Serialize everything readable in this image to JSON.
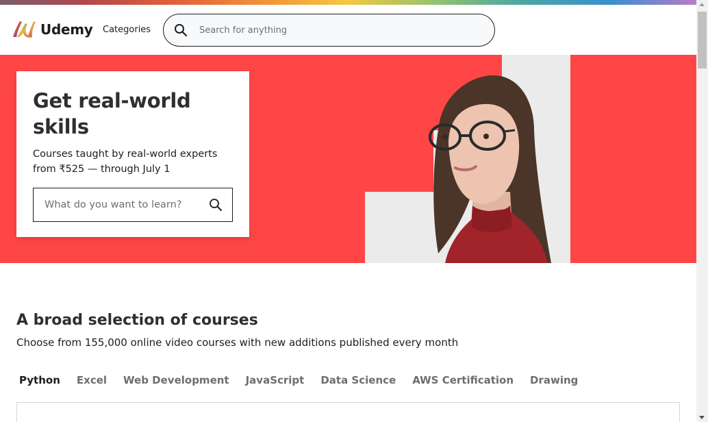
{
  "brand": {
    "name": "Udemy"
  },
  "header": {
    "categories_label": "Categories",
    "search_placeholder": "Search for anything"
  },
  "hero": {
    "title": "Get real-world skills",
    "subtitle": "Courses taught by real-world experts from ₹525 — through July 1",
    "search_placeholder": "What do you want to learn?",
    "background_color": "#ff4646"
  },
  "courses_section": {
    "title": "A broad selection of courses",
    "subtitle": "Choose from 155,000 online video courses with new additions published every month",
    "tabs": [
      {
        "label": "Python",
        "active": true
      },
      {
        "label": "Excel",
        "active": false
      },
      {
        "label": "Web Development",
        "active": false
      },
      {
        "label": "JavaScript",
        "active": false
      },
      {
        "label": "Data Science",
        "active": false
      },
      {
        "label": "AWS Certification",
        "active": false
      },
      {
        "label": "Drawing",
        "active": false
      }
    ]
  },
  "icons": {
    "logo": "udemy-logo-icon",
    "search": "search-icon",
    "hero_search": "search-icon"
  }
}
